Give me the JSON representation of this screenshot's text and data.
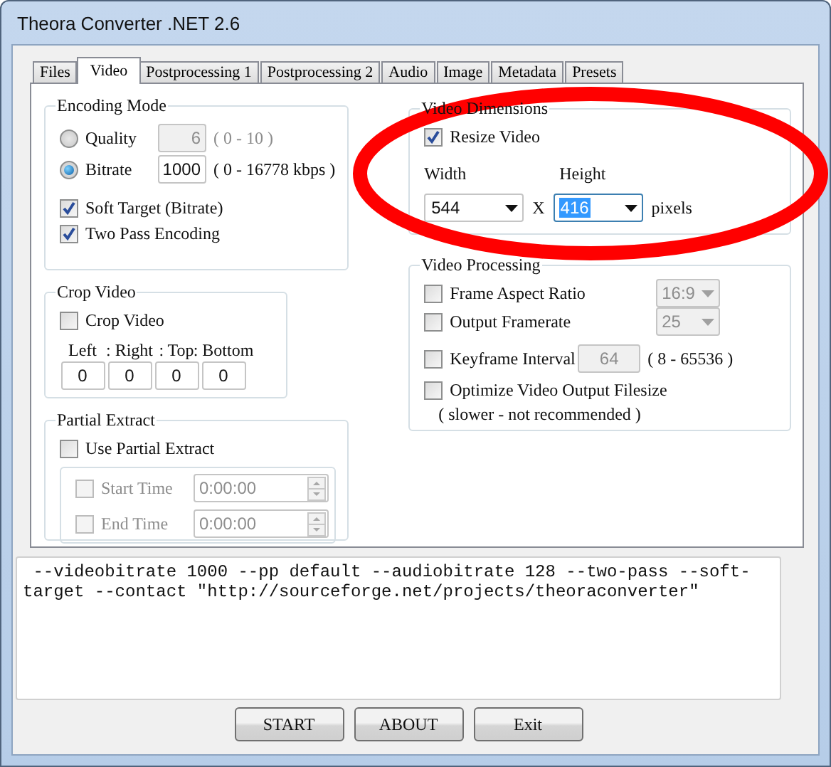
{
  "window": {
    "title": "Theora Converter .NET 2.6"
  },
  "tabs": [
    {
      "label": "Files",
      "selected": false
    },
    {
      "label": "Video",
      "selected": true
    },
    {
      "label": "Postprocessing 1",
      "selected": false
    },
    {
      "label": "Postprocessing 2",
      "selected": false
    },
    {
      "label": "Audio",
      "selected": false
    },
    {
      "label": "Image",
      "selected": false
    },
    {
      "label": "Metadata",
      "selected": false
    },
    {
      "label": "Presets",
      "selected": false
    }
  ],
  "encoding_mode": {
    "title": "Encoding Mode",
    "options": [
      {
        "label": "Quality",
        "selected": false,
        "value": "6",
        "range": "( 0 - 10 )",
        "disabled": true
      },
      {
        "label": "Bitrate",
        "selected": true,
        "value": "1000",
        "range": "( 0 - 16778 kbps )",
        "disabled": false
      }
    ],
    "checkboxes": [
      {
        "label": "Soft Target (Bitrate)",
        "checked": true
      },
      {
        "label": "Two Pass Encoding",
        "checked": true
      }
    ]
  },
  "crop_video": {
    "title": "Crop Video",
    "checkbox": {
      "label": "Crop Video",
      "checked": false
    },
    "fields": [
      {
        "label": "Left",
        "value": "0"
      },
      {
        "label": ": Right",
        "value": "0"
      },
      {
        "label": ": Top",
        "value": "0"
      },
      {
        "label": ": Bottom",
        "value": "0"
      }
    ]
  },
  "partial_extract": {
    "title": "Partial Extract",
    "checkbox": {
      "label": "Use Partial Extract",
      "checked": false
    },
    "rows": [
      {
        "label": "Start Time",
        "checked": false,
        "value": "0:00:00",
        "disabled": true
      },
      {
        "label": "End Time",
        "checked": false,
        "value": "0:00:00",
        "disabled": true
      }
    ]
  },
  "video_dimensions": {
    "title": "Video Dimensions",
    "checkbox": {
      "label": "Resize Video",
      "checked": true
    },
    "width": {
      "label": "Width",
      "value": "544",
      "selected": false
    },
    "separator": "X",
    "height": {
      "label": "Height",
      "value": "416",
      "selected": true
    },
    "unit": "pixels"
  },
  "video_processing": {
    "title": "Video Processing",
    "rows": [
      {
        "kind": "dropdown",
        "label": "Frame Aspect Ratio",
        "checked": false,
        "value": "16:9"
      },
      {
        "kind": "dropdown",
        "label": "Output Framerate",
        "checked": false,
        "value": "25"
      },
      {
        "kind": "number",
        "label": "Keyframe Interval",
        "checked": false,
        "value": "64",
        "range": "( 8 - 65536 )"
      },
      {
        "kind": "plain",
        "label": "Optimize Video Output Filesize",
        "checked": false,
        "note": "( slower - not recommended )"
      }
    ]
  },
  "command_line": " --videobitrate 1000 --pp default --audiobitrate 128 --two-pass --soft-target --contact \"http://sourceforge.net/projects/theoraconverter\"",
  "buttons": [
    "START",
    "ABOUT",
    "Exit"
  ]
}
